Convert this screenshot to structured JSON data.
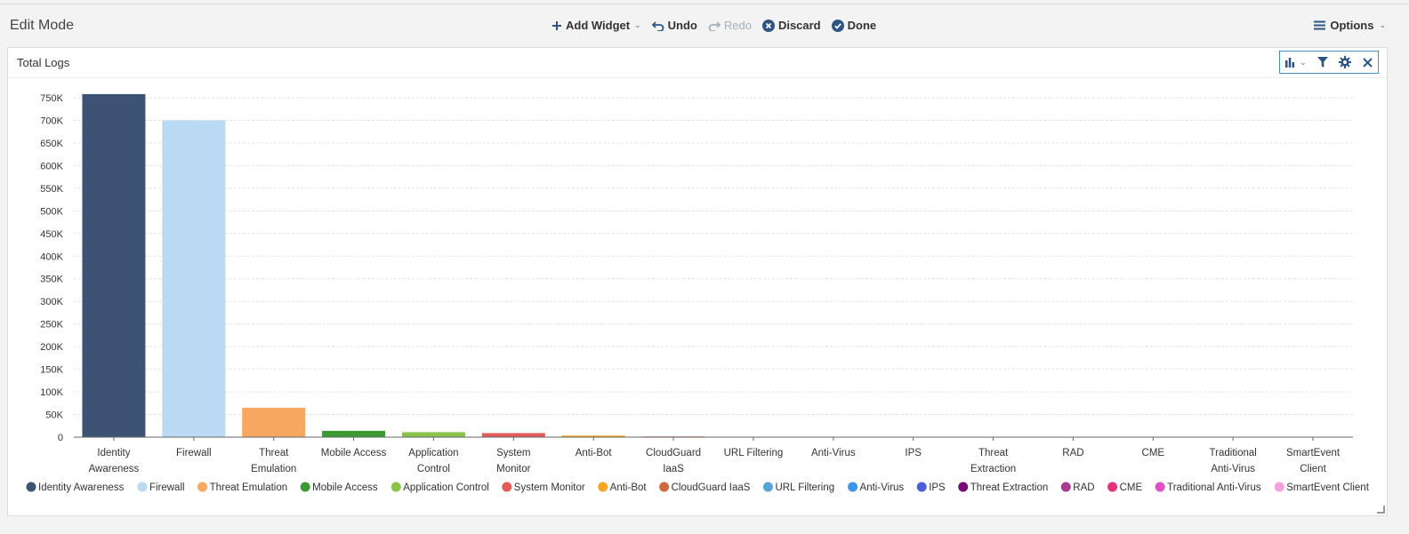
{
  "toolbar": {
    "mode_title": "Edit Mode",
    "add_widget_label": "Add Widget",
    "undo_label": "Undo",
    "redo_label": "Redo",
    "discard_label": "Discard",
    "done_label": "Done",
    "options_label": "Options"
  },
  "widget": {
    "title": "Total Logs",
    "icons": [
      "bar-chart-icon",
      "filter-icon",
      "gear-icon",
      "close-icon"
    ]
  },
  "colors": {
    "accent": "#2e5582",
    "tool_border": "#4a90c8"
  },
  "chart_data": {
    "type": "bar",
    "title": "Total Logs",
    "xlabel": "",
    "ylabel": "",
    "ylim": [
      0,
      750000
    ],
    "yticks": [
      "0",
      "50K",
      "100K",
      "150K",
      "200K",
      "250K",
      "300K",
      "350K",
      "400K",
      "450K",
      "500K",
      "550K",
      "600K",
      "650K",
      "700K",
      "750K"
    ],
    "grid": true,
    "legend_position": "bottom",
    "categories": [
      {
        "label_lines": [
          "Identity",
          "Awareness"
        ],
        "legend": "Identity Awareness",
        "value": 758000,
        "color": "#3d5275"
      },
      {
        "label_lines": [
          "Firewall"
        ],
        "legend": "Firewall",
        "value": 700000,
        "color": "#bad9f2"
      },
      {
        "label_lines": [
          "Threat",
          "Emulation"
        ],
        "legend": "Threat Emulation",
        "value": 65000,
        "color": "#f7a760"
      },
      {
        "label_lines": [
          "Mobile Access"
        ],
        "legend": "Mobile Access",
        "value": 14000,
        "color": "#3c9a34"
      },
      {
        "label_lines": [
          "Application",
          "Control"
        ],
        "legend": "Application Control",
        "value": 11000,
        "color": "#8bc34a"
      },
      {
        "label_lines": [
          "System",
          "Monitor"
        ],
        "legend": "System Monitor",
        "value": 9000,
        "color": "#e25c5c"
      },
      {
        "label_lines": [
          "Anti-Bot"
        ],
        "legend": "Anti-Bot",
        "value": 3500,
        "color": "#f5a623"
      },
      {
        "label_lines": [
          "CloudGuard",
          "IaaS"
        ],
        "legend": "CloudGuard IaaS",
        "value": 1500,
        "color": "#d1683d"
      },
      {
        "label_lines": [
          "URL Filtering"
        ],
        "legend": "URL Filtering",
        "value": 800,
        "color": "#56a5d8"
      },
      {
        "label_lines": [
          "Anti-Virus"
        ],
        "legend": "Anti-Virus",
        "value": 0,
        "color": "#3e97e8"
      },
      {
        "label_lines": [
          "IPS"
        ],
        "legend": "IPS",
        "value": 0,
        "color": "#4a5fd6"
      },
      {
        "label_lines": [
          "Threat",
          "Extraction"
        ],
        "legend": "Threat Extraction",
        "value": 0,
        "color": "#7a0a74"
      },
      {
        "label_lines": [
          "RAD"
        ],
        "legend": "RAD",
        "value": 0,
        "color": "#a63a8e"
      },
      {
        "label_lines": [
          "CME"
        ],
        "legend": "CME",
        "value": 0,
        "color": "#e6307a"
      },
      {
        "label_lines": [
          "Traditional",
          "Anti-Virus"
        ],
        "legend": "Traditional Anti-Virus",
        "value": 0,
        "color": "#e04fc3"
      },
      {
        "label_lines": [
          "SmartEvent",
          "Client"
        ],
        "legend": "SmartEvent Client",
        "value": 0,
        "color": "#f5a0dc"
      }
    ]
  }
}
